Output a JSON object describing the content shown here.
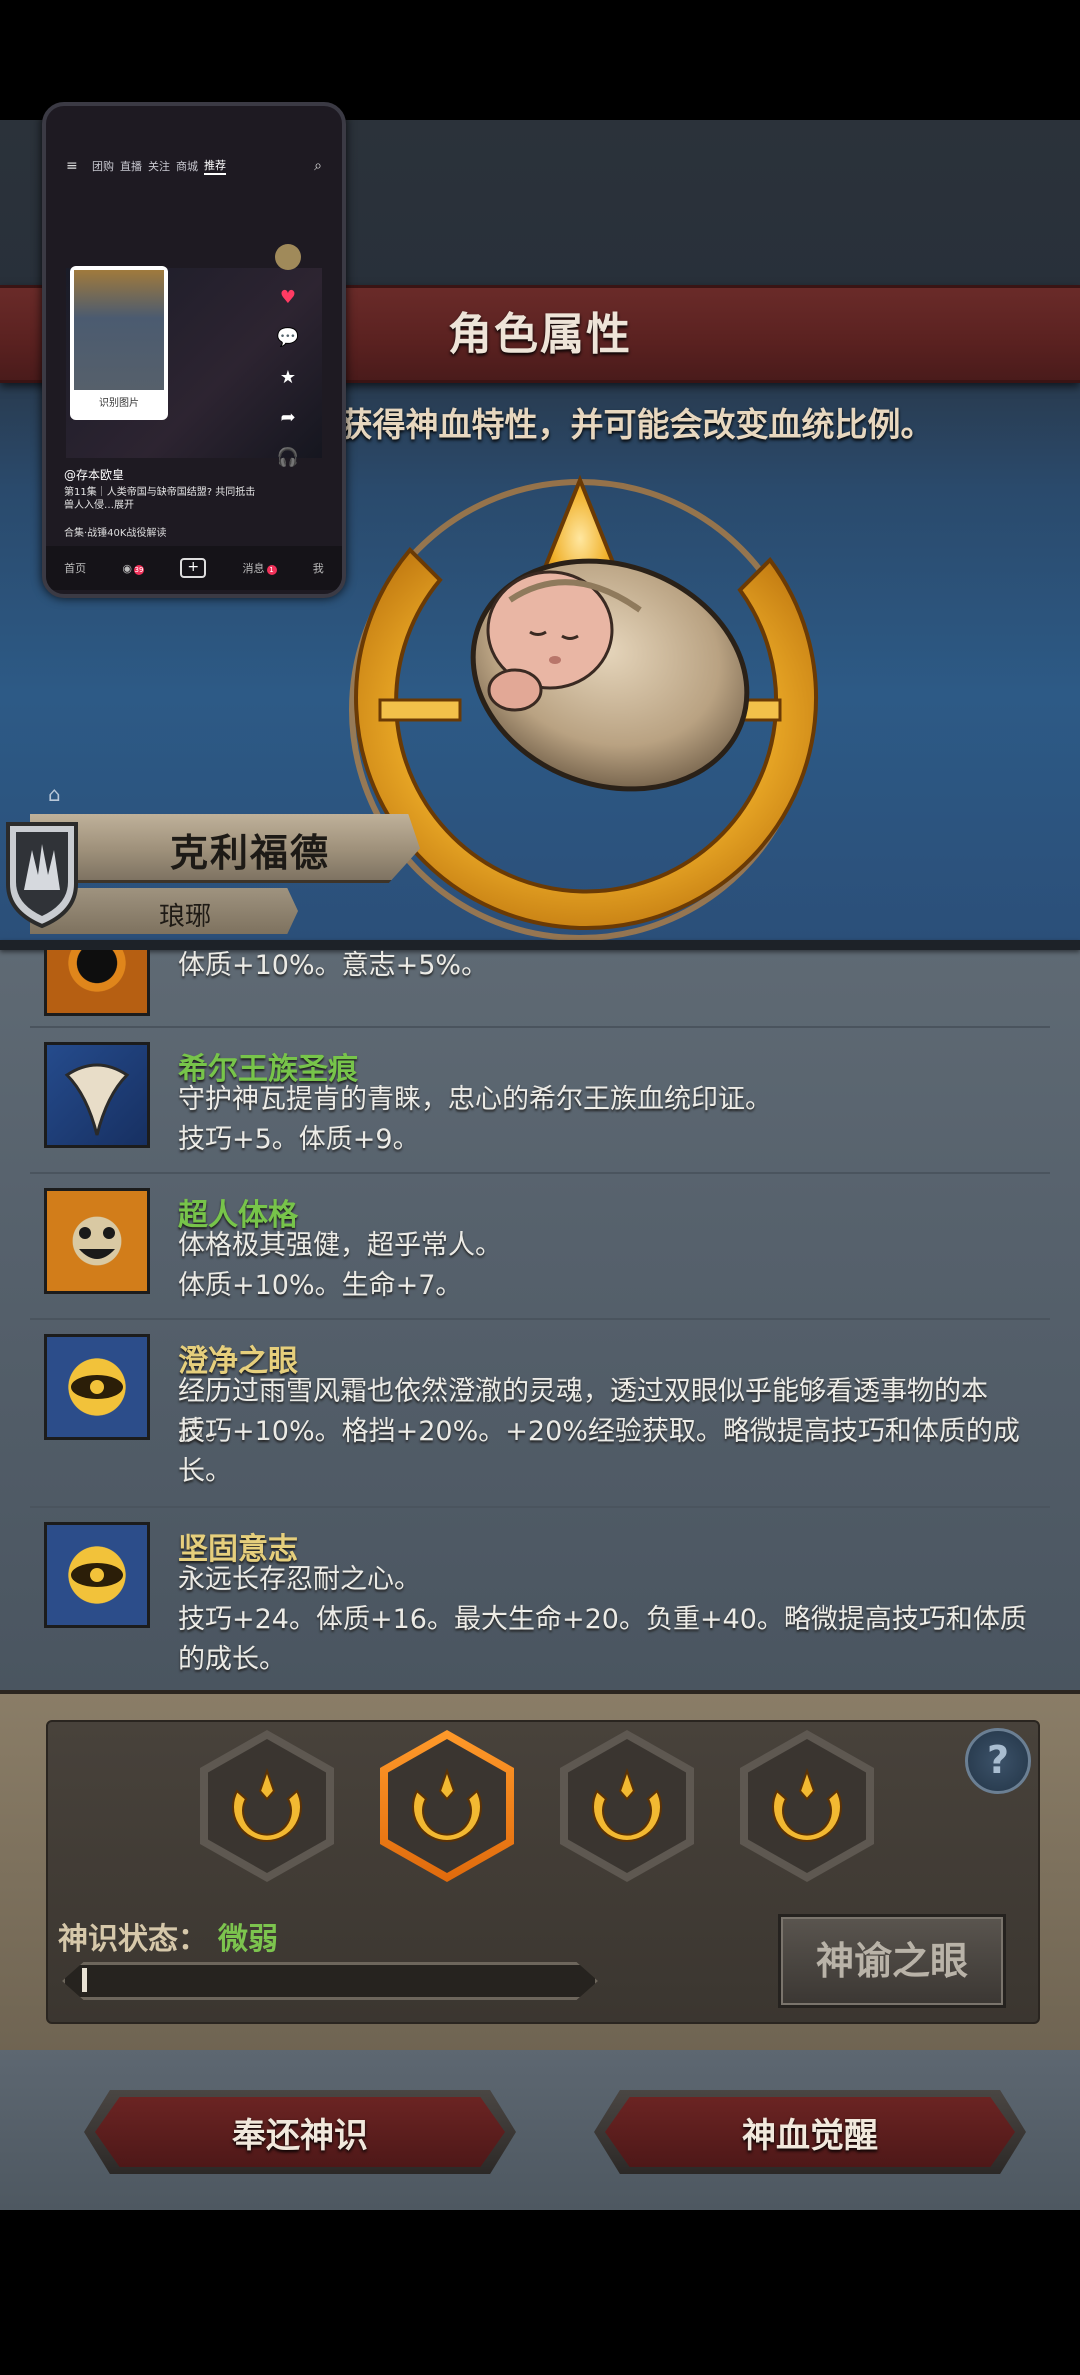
{
  "header": {
    "title": "角色属性"
  },
  "subtitle": "会获得神血特性，并可能会改变血统比例。",
  "character": {
    "name": "克利福德",
    "region": "琅琊"
  },
  "traits": [
    {
      "name": "",
      "desc_lines": [
        "体质+10%。意志+5%。"
      ],
      "icon": "orange-eye-icon"
    },
    {
      "name": "希尔王族圣痕",
      "desc_lines": [
        "守护神瓦提肯的青睐，忠心的希尔王族血统印证。",
        "技巧+5。体质+9。"
      ],
      "icon": "blue-crest-icon"
    },
    {
      "name": "超人体格",
      "desc_lines": [
        "体格极其强健，超乎常人。",
        "体质+10%。生命+7。"
      ],
      "icon": "smiling-face-icon"
    },
    {
      "name": "澄净之眼",
      "desc_lines": [
        "经历过雨雪风霜也依然澄澈的灵魂，透过双眼似乎能够看透事物的本质。",
        "技巧+10%。格挡+20%。+20%经验获取。略微提高技巧和体质的成",
        "长。"
      ],
      "icon": "golden-eye-emblem-icon"
    },
    {
      "name": "坚固意志",
      "desc_lines": [
        "永远长存忍耐之心。",
        "技巧+24。体质+16。最大生命+20。负重+40。略微提高技巧和体质",
        "的成长。"
      ],
      "icon": "golden-eye-emblem-icon"
    }
  ],
  "panel": {
    "status_label": "神识状态：",
    "status_value": "微弱",
    "progress_fraction": 0.01,
    "oracle_button": "神谕之眼",
    "help_label": "?",
    "selected_slot": 1
  },
  "buttons": {
    "return": "奉还神识",
    "awaken": "神血觉醒"
  },
  "phone_overlay": {
    "tabs": [
      "团购",
      "直播",
      "关注",
      "商城",
      "推荐"
    ],
    "card_label": "识别图片",
    "author": "@存本欧皇",
    "caption": "第11集｜人类帝国与缺帝国结盟? 共同抵击兽人入侵…展开",
    "music": "合集·战锤40K战役解读",
    "nav": [
      "首页",
      "",
      "+",
      "消息",
      "我"
    ],
    "nav_badge_1": "39",
    "nav_badge_3": "1"
  },
  "colors": {
    "trait_name_green": "#77c44a",
    "trait_name_gold": "#e6cf7c",
    "status_green": "#7cc44e",
    "button_red": "#6b2423",
    "header_red": "#5a2120"
  }
}
